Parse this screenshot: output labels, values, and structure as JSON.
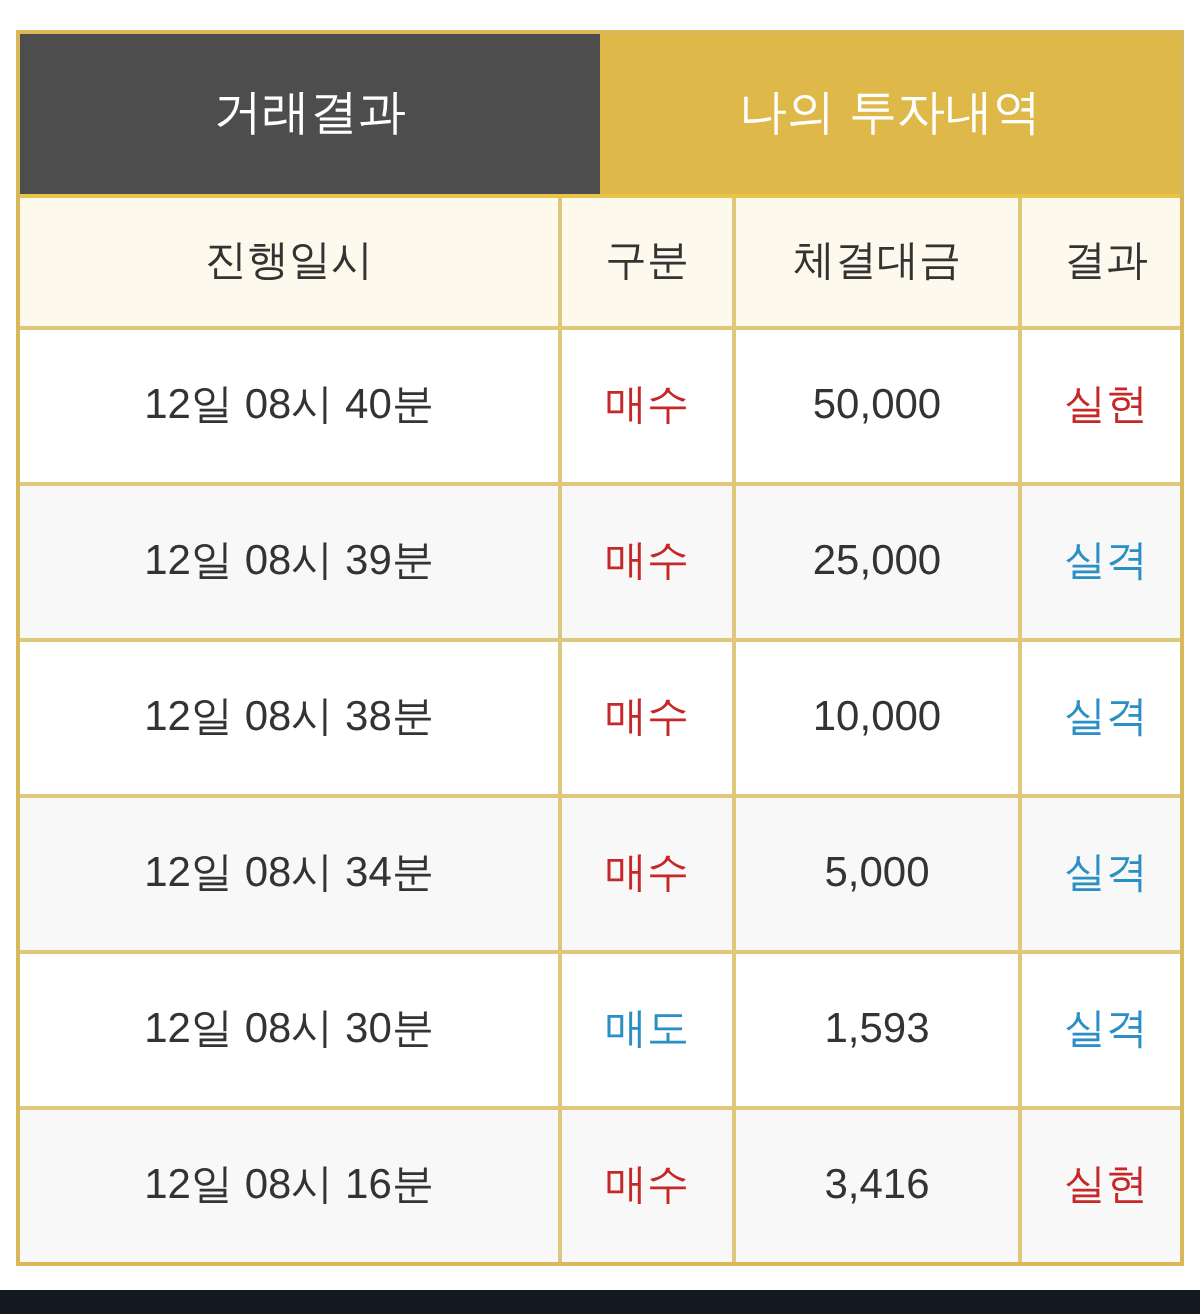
{
  "tabs": [
    {
      "label": "거래결과",
      "selected": false
    },
    {
      "label": "나의 투자내역",
      "selected": true
    }
  ],
  "table": {
    "columns": [
      "진행일시",
      "구분",
      "체결대금",
      "결과"
    ],
    "rows": [
      {
        "time": "12일 08시 40분",
        "type": {
          "text": "매수",
          "color": "#c62828"
        },
        "amount": "50,000",
        "result": {
          "text": "실현",
          "color": "#c62828"
        }
      },
      {
        "time": "12일 08시 39분",
        "type": {
          "text": "매수",
          "color": "#c62828"
        },
        "amount": "25,000",
        "result": {
          "text": "실격",
          "color": "#2a8fc4"
        }
      },
      {
        "time": "12일 08시 38분",
        "type": {
          "text": "매수",
          "color": "#c62828"
        },
        "amount": "10,000",
        "result": {
          "text": "실격",
          "color": "#2a8fc4"
        }
      },
      {
        "time": "12일 08시 34분",
        "type": {
          "text": "매수",
          "color": "#c62828"
        },
        "amount": "5,000",
        "result": {
          "text": "실격",
          "color": "#2a8fc4"
        }
      },
      {
        "time": "12일 08시 30분",
        "type": {
          "text": "매도",
          "color": "#2a8fc4"
        },
        "amount": "1,593",
        "result": {
          "text": "실격",
          "color": "#2a8fc4"
        }
      },
      {
        "time": "12일 08시 16분",
        "type": {
          "text": "매수",
          "color": "#c62828"
        },
        "amount": "3,416",
        "result": {
          "text": "실현",
          "color": "#c62828"
        }
      }
    ]
  }
}
